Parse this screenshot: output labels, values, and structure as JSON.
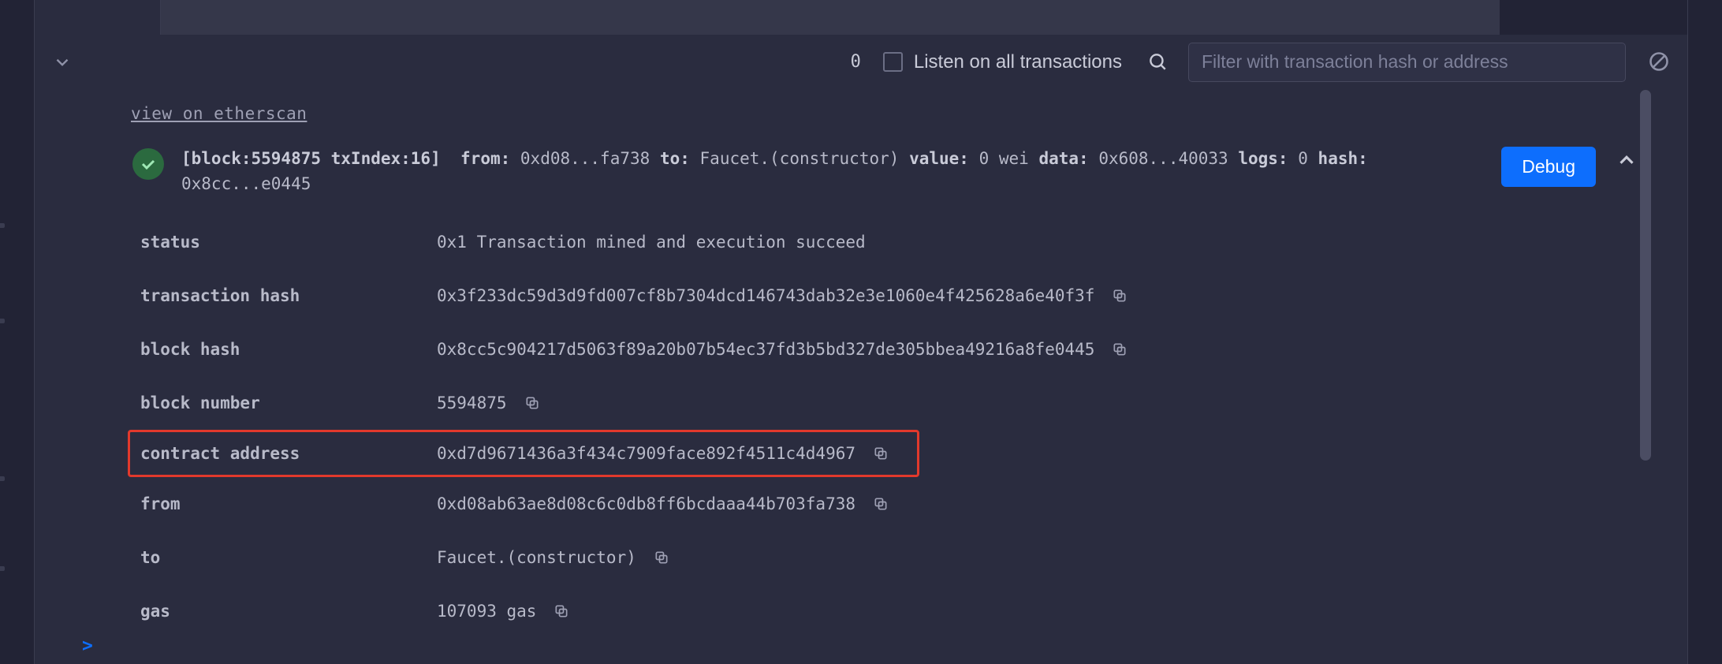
{
  "toolbar": {
    "count": "0",
    "listen_label": "Listen on all transactions",
    "filter_placeholder": "Filter with transaction hash or address"
  },
  "etherscan_link": "view on etherscan",
  "tx_header": {
    "block_label": "[block:5594875 txIndex:16]",
    "from_label": "from:",
    "from_val": "0xd08...fa738",
    "to_label": "to:",
    "to_val": "Faucet.(constructor)",
    "value_label": "value:",
    "value_val": "0 wei",
    "data_label": "data:",
    "data_val": "0x608...40033",
    "logs_label": "logs:",
    "logs_val": "0",
    "hash_label": "hash:",
    "hash_val": "0x8cc...e0445"
  },
  "debug_label": "Debug",
  "rows": {
    "status": {
      "label": "status",
      "value": "0x1 Transaction mined and execution succeed"
    },
    "transaction_hash": {
      "label": "transaction hash",
      "value": "0x3f233dc59d3d9fd007cf8b7304dcd146743dab32e3e1060e4f425628a6e40f3f"
    },
    "block_hash": {
      "label": "block hash",
      "value": "0x8cc5c904217d5063f89a20b07b54ec37fd3b5bd327de305bbea49216a8fe0445"
    },
    "block_number": {
      "label": "block number",
      "value": "5594875"
    },
    "contract_address": {
      "label": "contract address",
      "value": "0xd7d9671436a3f434c7909face892f4511c4d4967"
    },
    "from": {
      "label": "from",
      "value": "0xd08ab63ae8d08c6c0db8ff6bcdaaa44b703fa738"
    },
    "to": {
      "label": "to",
      "value": "Faucet.(constructor)"
    },
    "gas": {
      "label": "gas",
      "value": "107093 gas"
    }
  },
  "prompt": ">"
}
